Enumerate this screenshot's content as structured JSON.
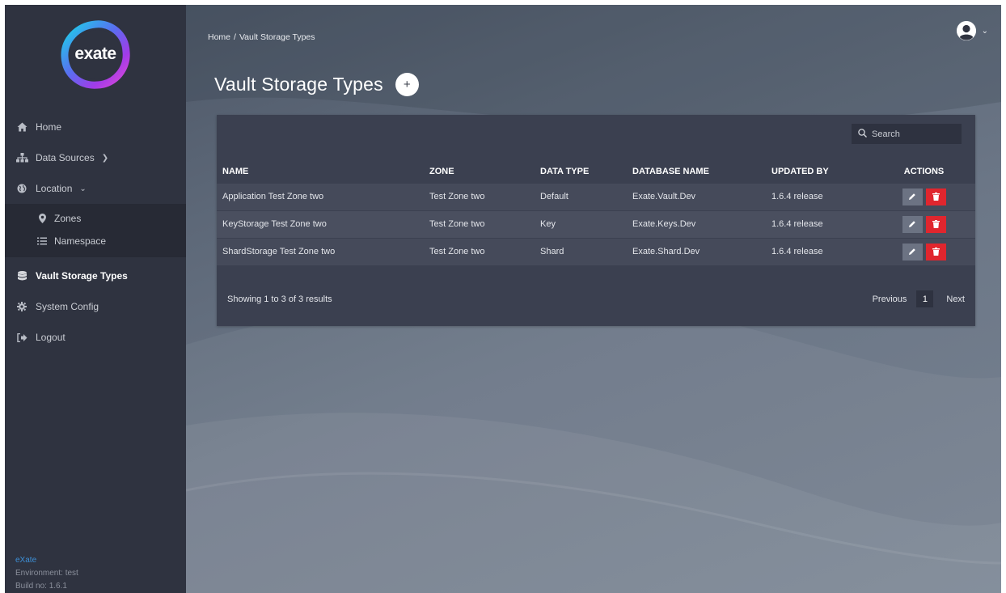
{
  "brand": {
    "logo_text": "exate",
    "accent_colors": [
      "#18c7e0",
      "#7c3aed",
      "#d946ef"
    ]
  },
  "sidebar": {
    "items": [
      {
        "label": "Home",
        "icon": "home-icon"
      },
      {
        "label": "Data Sources",
        "icon": "sitemap-icon"
      },
      {
        "label": "Location",
        "icon": "globe-icon"
      },
      {
        "label": "Vault Storage Types",
        "icon": "database-icon"
      },
      {
        "label": "System Config",
        "icon": "gear-icon"
      },
      {
        "label": "Logout",
        "icon": "logout-icon"
      }
    ],
    "location_children": [
      {
        "label": "Zones",
        "icon": "map-pin-icon"
      },
      {
        "label": "Namespace",
        "icon": "list-icon"
      }
    ],
    "footer": {
      "brand": "eXate",
      "environment": "Environment: test",
      "build": "Build no: 1.6.1"
    }
  },
  "breadcrumb": {
    "home": "Home",
    "separator": "/",
    "current": "Vault Storage Types"
  },
  "page": {
    "title": "Vault Storage Types",
    "add_label": "+"
  },
  "search": {
    "placeholder": "Search"
  },
  "table": {
    "headers": {
      "name": "NAME",
      "zone": "ZONE",
      "data_type": "DATA TYPE",
      "database_name": "DATABASE NAME",
      "updated_by": "UPDATED BY",
      "actions": "ACTIONS"
    },
    "rows": [
      {
        "name": "Application Test Zone two",
        "zone": "Test Zone two",
        "data_type": "Default",
        "database_name": "Exate.Vault.Dev",
        "updated_by": "1.6.4 release"
      },
      {
        "name": "KeyStorage Test Zone two",
        "zone": "Test Zone two",
        "data_type": "Key",
        "database_name": "Exate.Keys.Dev",
        "updated_by": "1.6.4 release"
      },
      {
        "name": "ShardStorage Test Zone two",
        "zone": "Test Zone two",
        "data_type": "Shard",
        "database_name": "Exate.Shard.Dev",
        "updated_by": "1.6.4 release"
      }
    ]
  },
  "pagination": {
    "summary": "Showing 1 to 3 of 3 results",
    "previous": "Previous",
    "current_page": "1",
    "next": "Next"
  },
  "colors": {
    "sidebar_bg": "#2f3340",
    "panel_bg": "#3b4050",
    "delete_red": "#e0262e",
    "edit_gray": "#6c7383"
  }
}
